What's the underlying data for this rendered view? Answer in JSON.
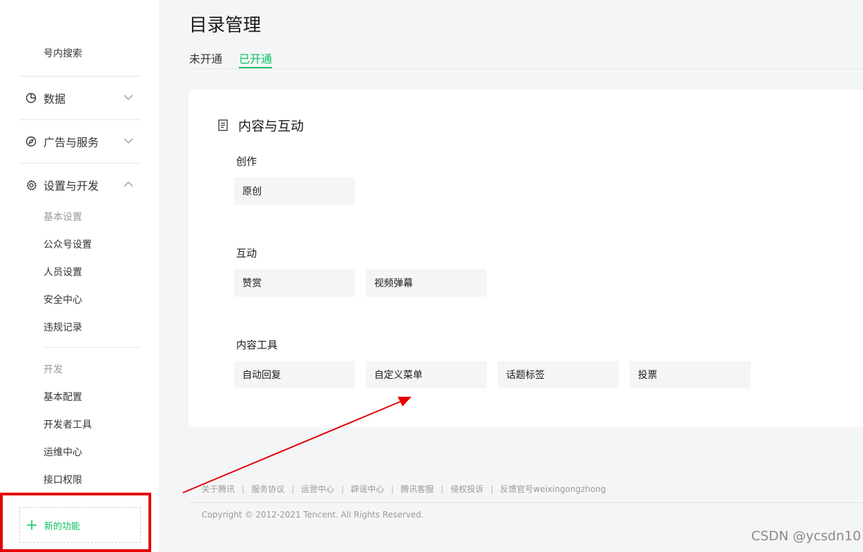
{
  "sidebar": {
    "search_item": "号内搜索",
    "groups": [
      {
        "label": "数据",
        "icon": "pie-chart-icon",
        "expanded": false
      },
      {
        "label": "广告与服务",
        "icon": "compass-icon",
        "expanded": false
      },
      {
        "label": "设置与开发",
        "icon": "gear-icon",
        "expanded": true
      }
    ],
    "settings_heading": "基本设置",
    "settings_items": [
      "公众号设置",
      "人员设置",
      "安全中心",
      "违规记录"
    ],
    "dev_heading": "开发",
    "dev_items": [
      "基本配置",
      "开发者工具",
      "运维中心",
      "接口权限"
    ],
    "new_feature_label": "新的功能"
  },
  "main": {
    "title": "目录管理",
    "tabs": [
      {
        "label": "未开通",
        "active": false
      },
      {
        "label": "已开通",
        "active": true
      }
    ],
    "section_title": "内容与互动",
    "categories": [
      {
        "label": "创作",
        "items": [
          "原创"
        ]
      },
      {
        "label": "互动",
        "items": [
          "赞赏",
          "视频弹幕"
        ]
      },
      {
        "label": "内容工具",
        "items": [
          "自动回复",
          "自定义菜单",
          "话题标签",
          "投票"
        ]
      }
    ]
  },
  "footer": {
    "links": [
      "关于腾讯",
      "服务协议",
      "运营中心",
      "辟谣中心",
      "腾讯客服",
      "侵权投诉",
      "反馈官号weixingongzhong"
    ],
    "separator": "|",
    "copyright": "Copyright © 2012-2021 Tencent. All Rights Reserved."
  },
  "watermark": "CSDN @ycsdn10",
  "colors": {
    "accent": "#07c160",
    "annotation_red": "#e40000",
    "page_bg": "#f4f5f7"
  }
}
